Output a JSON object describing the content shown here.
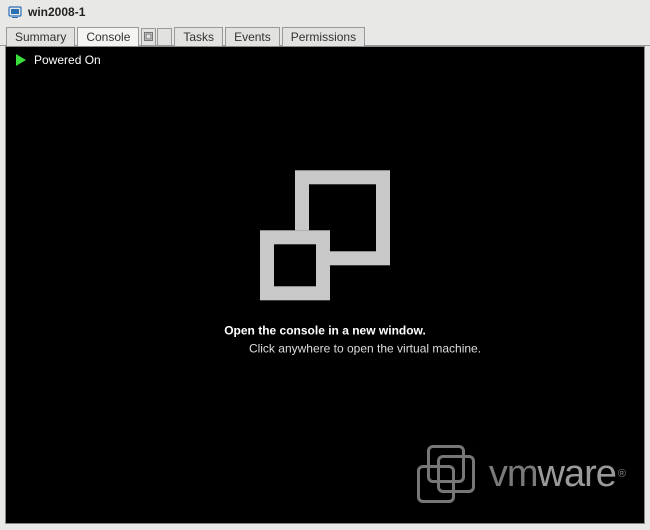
{
  "title": "win2008-1",
  "tabs": {
    "summary": "Summary",
    "console": "Console",
    "tasks": "Tasks",
    "events": "Events",
    "permissions": "Permissions"
  },
  "status": "Powered On",
  "center": {
    "headline": "Open the console in a new window.",
    "hint": "Click anywhere to open the virtual machine."
  },
  "watermark": {
    "brand_strong": "vm",
    "brand_light": "ware",
    "reg": "®"
  }
}
